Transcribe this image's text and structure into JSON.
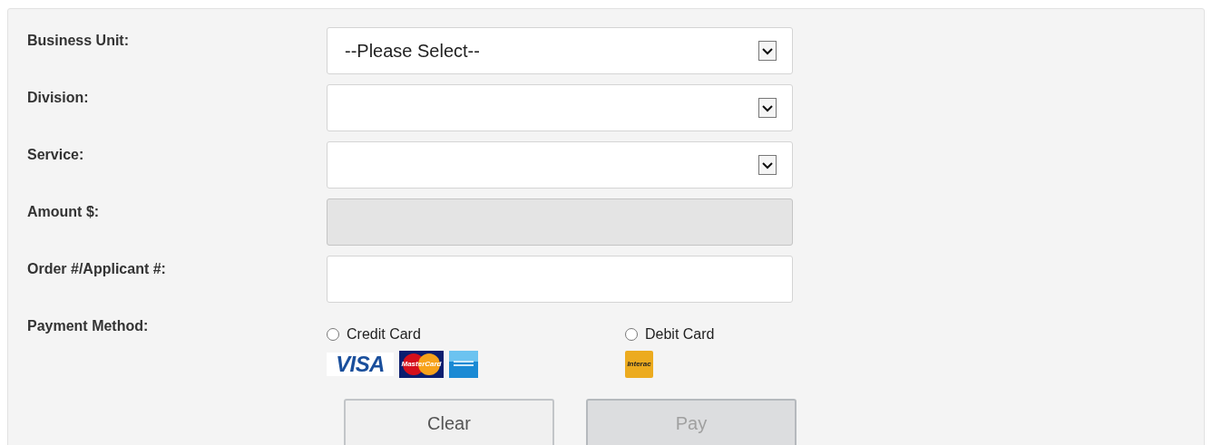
{
  "fields": [
    {
      "label": "Business Unit:",
      "kind": "select",
      "value": "--Please Select--",
      "disabled": false
    },
    {
      "label": "Division:",
      "kind": "select",
      "disabled": false
    },
    {
      "label": "Service:",
      "kind": "select",
      "disabled": false
    },
    {
      "label": "Amount $:",
      "kind": "input",
      "disabled": true
    },
    {
      "label": "Order #/Applicant #:",
      "kind": "input",
      "disabled": false
    }
  ],
  "payment": {
    "label": "Payment Method:",
    "options": [
      {
        "label": "Credit Card",
        "selected": false,
        "logos": [
          {
            "kind": "visa",
            "text": "VISA"
          },
          {
            "kind": "mastercard",
            "text": "MasterCard"
          },
          {
            "kind": "amex"
          }
        ]
      },
      {
        "label": "Debit Card",
        "selected": false,
        "logos": [
          {
            "kind": "interac",
            "text": "Interac"
          }
        ]
      }
    ]
  },
  "buttons": [
    {
      "label": "Clear",
      "disabled": false
    },
    {
      "label": "Pay",
      "disabled": true
    }
  ]
}
